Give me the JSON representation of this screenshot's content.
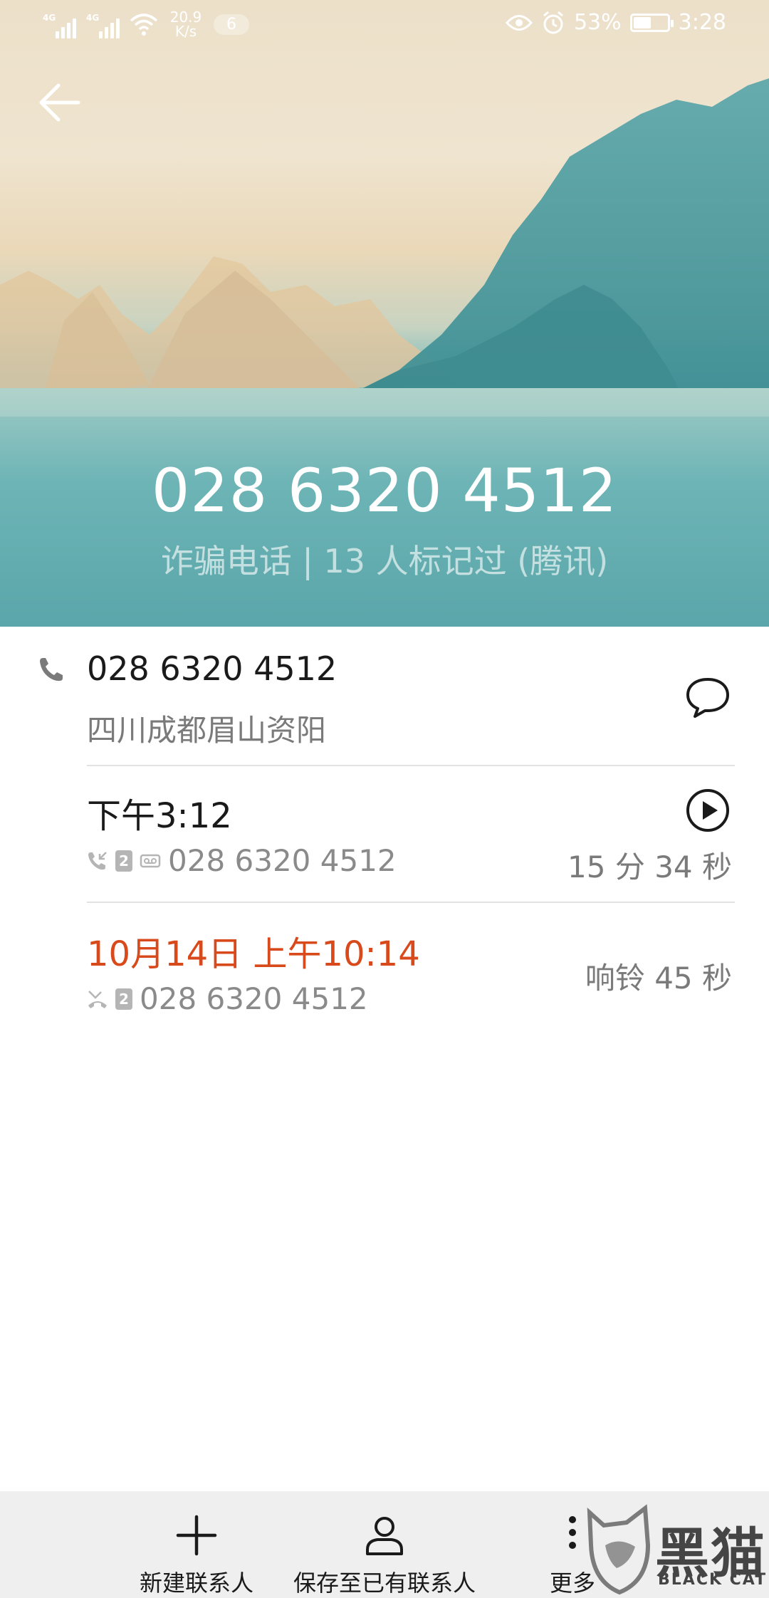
{
  "status_bar": {
    "network_1": "4G",
    "network_2": "4G",
    "speed_value": "20.9",
    "speed_unit": "K/s",
    "notification_count": "6",
    "battery": "53%",
    "time": "3:28",
    "battery_level": 0.53,
    "icons": [
      "signal-icon",
      "wifi-icon",
      "eye-icon",
      "alarm-icon",
      "battery-icon"
    ]
  },
  "header": {
    "number": "028 6320 4512",
    "tag": "诈骗电话 | 13 人标记过 (腾讯)"
  },
  "contact": {
    "number": "028 6320 4512",
    "location": "四川成都眉山资阳"
  },
  "calls": [
    {
      "time": "下午3:12",
      "number": "028 6320 4512",
      "sim": "2",
      "duration": "15 分 34 秒"
    },
    {
      "time": "10月14日 上午10:14",
      "number": "028 6320 4512",
      "sim": "2",
      "duration": "响铃 45 秒"
    }
  ],
  "actions": {
    "new_contact": "新建联系人",
    "save_existing": "保存至已有联系人",
    "more": "更多"
  },
  "watermark": {
    "cn": "黑猫",
    "en": "BLACK CAT"
  },
  "colors": {
    "missed_call": "#d84a1b",
    "teal": "#5da9ad",
    "sand": "#ece0c9"
  }
}
